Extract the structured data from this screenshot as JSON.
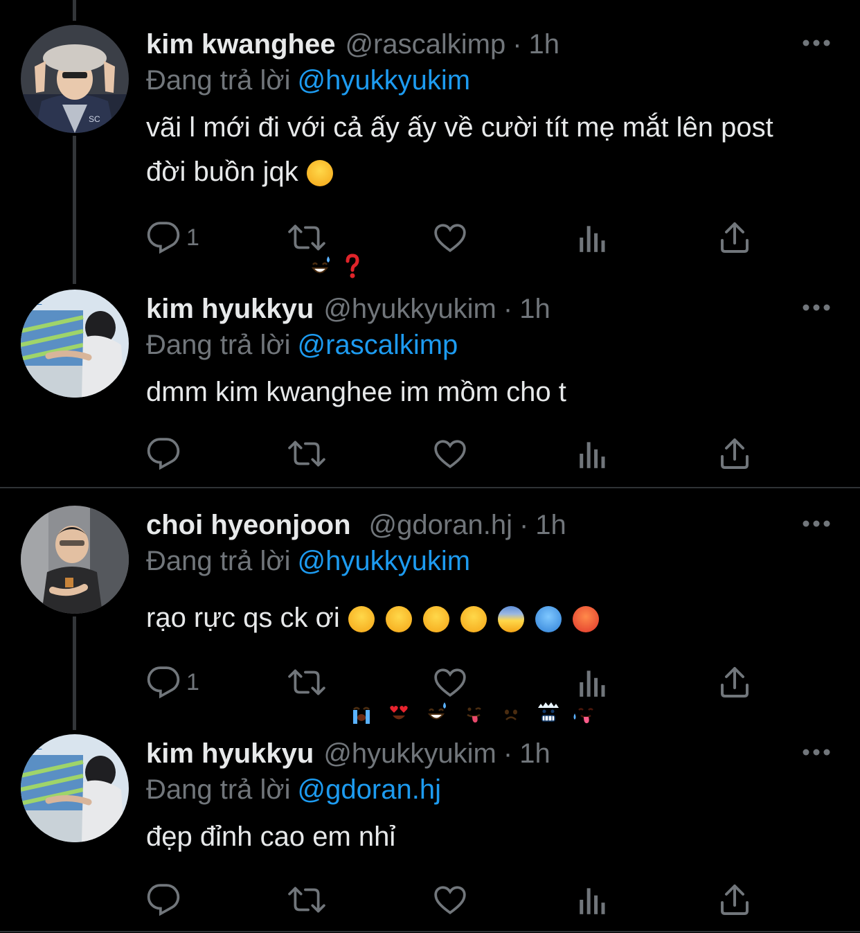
{
  "colors": {
    "background": "#000000",
    "text": "#e7e9ea",
    "muted": "#71767b",
    "link": "#1d9bf0",
    "thread_line": "#333639",
    "divider": "#2f3336"
  },
  "reply_label": "Đang trả lời",
  "tweets": [
    {
      "display_name": "kim kwanghee",
      "handle": "@rascalkimp",
      "separator": "·",
      "time": "1h",
      "reply_to": "@hyukkyukim",
      "text": "vãi l mới đi với cả ấy ấy về cười tít mẹ mắt lên post\nđời buồn jqk",
      "emojis": [
        "grinning-sweat-emoji",
        "red-question-mark"
      ],
      "reply_count": "1",
      "avatar_icon": "avatar-kim-kwanghee"
    },
    {
      "display_name": "kim hyukkyu",
      "handle": "@hyukkyukim",
      "separator": "·",
      "time": "1h",
      "reply_to": "@rascalkimp",
      "text": "dmm kim kwanghee im mồm cho t",
      "emojis": [],
      "reply_count": "",
      "avatar_icon": "avatar-kim-hyukkyu"
    },
    {
      "display_name": "choi hyeonjoon",
      "handle": "@gdoran.hj",
      "separator": "·",
      "time": "1h",
      "reply_to": "@hyukkyukim",
      "text": "rạo rực qs ck ơi",
      "emojis": [
        "loudly-crying-emoji",
        "heart-eyes-emoji",
        "grinning-sweat-emoji",
        "tongue-out-emoji",
        "fearful-emoji",
        "cold-face-emoji",
        "hot-face-emoji"
      ],
      "reply_count": "1",
      "avatar_icon": "avatar-choi-hyeonjoon"
    },
    {
      "display_name": "kim hyukkyu",
      "handle": "@hyukkyukim",
      "separator": "·",
      "time": "1h",
      "reply_to": "@gdoran.hj",
      "text": "đẹp đỉnh cao em nhỉ",
      "emojis": [],
      "reply_count": "",
      "avatar_icon": "avatar-kim-hyukkyu"
    }
  ],
  "action_icons": [
    "reply-icon",
    "retweet-icon",
    "like-icon",
    "analytics-icon",
    "share-icon"
  ]
}
